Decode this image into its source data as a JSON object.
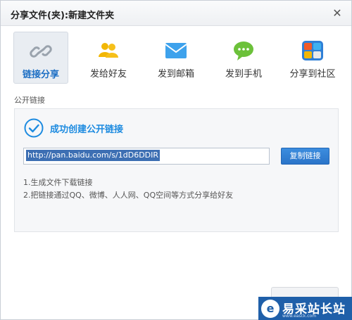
{
  "window": {
    "title": "分享文件(夹):新建文件夹"
  },
  "tabs": [
    {
      "label": "链接分享",
      "icon": "link-icon",
      "active": true
    },
    {
      "label": "发给好友",
      "icon": "friends-icon",
      "active": false
    },
    {
      "label": "发到邮箱",
      "icon": "mail-icon",
      "active": false
    },
    {
      "label": "发到手机",
      "icon": "chat-bubble-icon",
      "active": false
    },
    {
      "label": "分享到社区",
      "icon": "community-icon",
      "active": false
    }
  ],
  "section": {
    "label": "公开链接"
  },
  "share": {
    "status": "成功创建公开链接",
    "link": "http://pan.baidu.com/s/1dD6DDIR",
    "copy_label": "复制链接",
    "steps": [
      "1.生成文件下载链接",
      "2.把链接通过QQ、微博、人人网、QQ空间等方式分享给好友"
    ]
  },
  "watermark": {
    "name": "易采站长站",
    "url": "www.easck.com"
  },
  "colors": {
    "accent": "#1d8be0",
    "button": "#2a74c9",
    "active_tab": "#1d6fc4"
  }
}
